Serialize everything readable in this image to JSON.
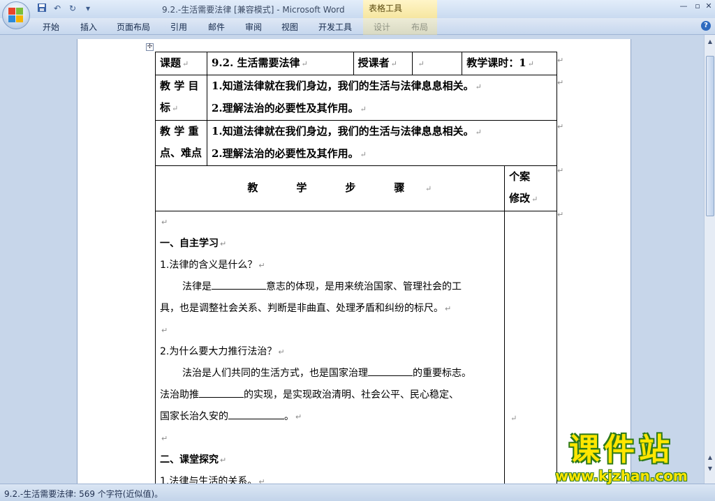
{
  "window": {
    "title": "9.2.-生活需要法律 [兼容模式] - Microsoft Word",
    "context_group": "表格工具",
    "controls": [
      "—",
      "▫",
      "✕"
    ]
  },
  "qat": {
    "save_icon": "save-icon",
    "undo_icon": "undo-icon",
    "redo_icon": "redo-icon",
    "customize": "▾"
  },
  "ribbon": {
    "tabs": [
      "开始",
      "插入",
      "页面布局",
      "引用",
      "邮件",
      "审阅",
      "视图",
      "开发工具",
      "设计",
      "布局"
    ]
  },
  "table": {
    "row1": {
      "label": "课题",
      "title": "9.2. 生活需要法律",
      "teacher_label": "授课者",
      "teacher_value": "",
      "hours_label": "教学课时：1"
    },
    "row2": {
      "label_line1": "教 学 目",
      "label_line2": "标",
      "items": [
        "1.知道法律就在我们身边，我们的生活与法律息息相关。",
        "2.理解法治的必要性及其作用。"
      ]
    },
    "row3": {
      "label_line1": "教 学 重",
      "label_line2": "点、难点",
      "items": [
        "1.知道法律就在我们身边，我们的生活与法律息息相关。",
        "2.理解法治的必要性及其作用。"
      ]
    },
    "steps_header": [
      "教",
      "学",
      "步",
      "骤"
    ],
    "personal_header": [
      "个案",
      "修改"
    ],
    "body": {
      "section1": "一、自主学习",
      "q1": "1.法律的含义是什么？",
      "a1_line1_a": "法律是",
      "a1_line1_b": "意志的体现，是用来统治国家、管理社会的工",
      "a1_line2": "具，也是调整社会关系、判断是非曲直、处理矛盾和纠纷的标尺。",
      "q2": "2.为什么要大力推行法治？",
      "a2_line1_a": "法治是人们共同的生活方式，也是国家治理",
      "a2_line1_b": "的重要标志。",
      "a2_line2_a": "法治助推",
      "a2_line2_b": "的实现，是实现政治清明、社会公平、民心稳定、",
      "a2_line3_a": "国家长治久安的",
      "a2_line3_b": "。",
      "section2": "二、课堂探究",
      "q3": "1.法律与生活的关系。"
    },
    "para_mark": "↵"
  },
  "status": {
    "text": "9.2.-生活需要法律: 569 个字符(近似值)。"
  },
  "watermark": {
    "title": "课件站",
    "url": "www.kjzhan.com"
  }
}
